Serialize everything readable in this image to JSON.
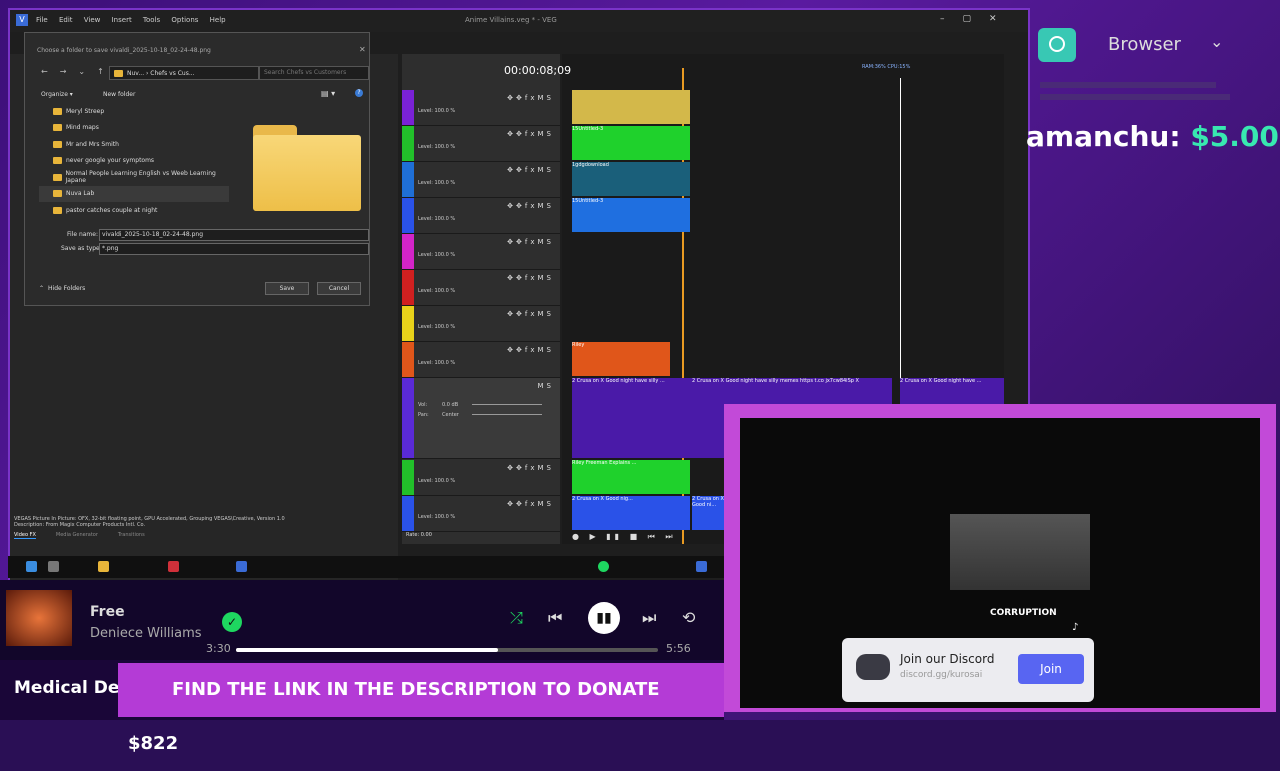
{
  "vegas": {
    "menu": [
      "File",
      "Edit",
      "View",
      "Insert",
      "Tools",
      "Options",
      "Help"
    ],
    "window_title": "Anime Villains.veg * - VEG",
    "timecode": "00:00:08;09",
    "ram_cpu": "RAM:36%  CPU:15%",
    "plugin_info": "VEGAS Picture In Picture: OFX, 32-bit floating point, GPU Accelerated, Grouping VEGAS\\Creative, Version 1.0",
    "plugin_desc": "Description: From Magix Computer Products Intl. Co.",
    "bottom_tabs": [
      "Video FX",
      "Media Generator",
      "Transitions"
    ],
    "rate": "Rate: 0.00",
    "tracks": [
      {
        "level": "Level: 100.0 %",
        "color": "#7a22d6"
      },
      {
        "level": "Level: 100.0 %",
        "color": "#22c02a"
      },
      {
        "level": "Level: 100.0 %",
        "color": "#1f6fd6"
      },
      {
        "level": "Level: 100.0 %",
        "color": "#2a52e8"
      },
      {
        "level": "Level: 100.0 %",
        "color": "#d324c8"
      },
      {
        "level": "Level: 100.0 %",
        "color": "#d02020"
      },
      {
        "level": "Level: 100.0 %",
        "color": "#e8d21a"
      },
      {
        "level": "Level: 100.0 %",
        "color": "#e0561a"
      }
    ],
    "audio_track": {
      "vol_label": "Vol:",
      "vol": "0.0 dB",
      "pan_label": "Pan:",
      "pan": "Center"
    },
    "bottom_tracks": [
      {
        "level": "Level: 100.0 %",
        "color": "#22c02a"
      },
      {
        "level": "Level: 100.0 %",
        "color": "#2a52e8"
      }
    ],
    "clips": {
      "c1": "15Untitled-3",
      "c2": "1gdgdownload",
      "c3": "15Untitled-3",
      "c4": "Riley",
      "audio1": "2 Crusa on X Good night have silly ...",
      "audio2": "2 Crusa on X Good night have silly memes https t.co jx7cw84iSp X",
      "audio3": "2 Crusa on X Good night have ...",
      "c5": "Riley Freeman Explains ...",
      "c6": "2 Crusa on X Good nig...",
      "c7": "2 Crusa on X Good ni..."
    }
  },
  "dialog": {
    "title": "Choose a folder to save vivaldi_2025-10-18_02-24-48.png",
    "breadcrumb": "Nuv... › Chefs vs Cus...",
    "search_placeholder": "Search Chefs vs Customers",
    "organize": "Organize ▾",
    "new_folder": "New folder",
    "folders": [
      "Meryl Streep",
      "Mind maps",
      "Mr and Mrs Smith",
      "never google your symptoms",
      "Normal People Learning English vs Weeb Learning Japane",
      "Nuva Lab",
      "pastor catches couple at night"
    ],
    "file_name_label": "File name:",
    "file_name": "vivaldi_2025-10-18_02-24-48.png",
    "save_type_label": "Save as type:",
    "save_type": "*.png",
    "hide_folders": "Hide Folders",
    "save": "Save",
    "cancel": "Cancel"
  },
  "overlay": {
    "browser_label": "Browser",
    "donor": "amanchu:",
    "donation": "$5.00",
    "discord_title": "Join our Discord",
    "discord_link": "discord.gg/kurosai",
    "discord_join": "Join",
    "video_caption": "CORRUPTION"
  },
  "player": {
    "song": "Free",
    "artist": "Deniece Williams",
    "elapsed": "3:30",
    "total": "5:56",
    "progress": 0.62
  },
  "banner": {
    "label": "Medical Debt",
    "ticker": "FIND THE LINK IN THE DESCRIPTION TO DONATE",
    "amount": "$822"
  }
}
